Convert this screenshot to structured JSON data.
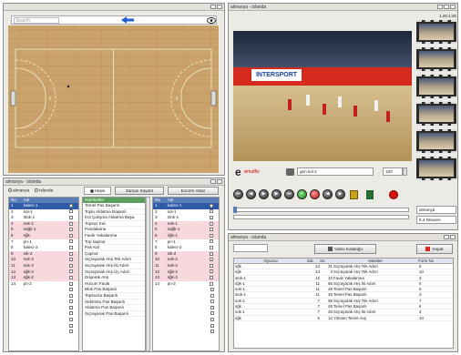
{
  "court_window": {
    "search_placeholder": "Search"
  },
  "video_window": {
    "title": "almanya - islanda"
  },
  "video": {
    "banner": "INTERSPORT",
    "brand_letter": "e",
    "brand_name": "vimaffix",
    "camera": "gen kol 2",
    "zoom": "100"
  },
  "filmstrip": {
    "timecode": "1:25:1:25"
  },
  "side_panel": {
    "team_select": "almanya",
    "size_select": "6.4 Nüvuen"
  },
  "roster_window": {
    "title": "almanya - islanda",
    "radio_team1": "almanya",
    "radio_team2": "islanda",
    "radio_hepsi": "Hepsi",
    "btn_zaman": "Zaman Kaydet",
    "btn_excel": "Excel'e Aktar",
    "left_table": {
      "headers": [
        "No",
        "Adı",
        ""
      ],
      "rows": [
        {
          "no": "1",
          "name": "kaleci-1"
        },
        {
          "no": "2",
          "name": "sol-1"
        },
        {
          "no": "3",
          "name": "stok-1"
        },
        {
          "no": "4",
          "name": "sok-1"
        },
        {
          "no": "5",
          "name": "sağk-1"
        },
        {
          "no": "6",
          "name": "sğk"
        },
        {
          "no": "7",
          "name": "pn-1"
        },
        {
          "no": "8",
          "name": "kaleci-2"
        },
        {
          "no": "9",
          "name": "sik-2"
        },
        {
          "no": "10",
          "name": "sok-2"
        },
        {
          "no": "11",
          "name": "sok-2"
        },
        {
          "no": "12",
          "name": "sğk-2"
        },
        {
          "no": "13",
          "name": "sğk-2"
        },
        {
          "no": "14",
          "name": "pn-2"
        }
      ]
    },
    "actions_header": "Hareketler",
    "actions": [
      "Temel Pas Başarılı",
      "Toplu Aldatma Başarılı",
      "Kol Çalışma Aldatma Başa",
      "Topsuz Kal",
      "Pandalama",
      "Faule Yakalanma",
      "Top kapma",
      "Pas Kal",
      "Çapraz",
      "Sıçrayarak Atış Tek Adım",
      "Sıçrayarak Atış İki Adım",
      "Sıçrayarak Atış Üç Adım",
      "Düşerek Atış",
      "Hücum Faulü",
      "Blok Pas Başarılı",
      "Topsuzsa Başarılı",
      "Sektörsu Pas Başarılı",
      "Aldatma Pas Başarılı",
      "Sıçrayarak Pas Başarılı"
    ],
    "right_table": {
      "headers": [
        "No",
        "Adı",
        ""
      ],
      "rows": [
        {
          "no": "1",
          "name": "kaleci-1"
        },
        {
          "no": "2",
          "name": "sol-1"
        },
        {
          "no": "3",
          "name": "stok-1"
        },
        {
          "no": "4",
          "name": "sok-1"
        },
        {
          "no": "5",
          "name": "sağk-1"
        },
        {
          "no": "6",
          "name": "sğk-1"
        },
        {
          "no": "7",
          "name": "pn-1"
        },
        {
          "no": "8",
          "name": "kaleci-2"
        },
        {
          "no": "9",
          "name": "sik-2"
        },
        {
          "no": "10",
          "name": "sok-2"
        },
        {
          "no": "11",
          "name": "sok-2"
        },
        {
          "no": "12",
          "name": "sğk-2"
        },
        {
          "no": "13",
          "name": "sğk-2"
        },
        {
          "no": "14",
          "name": "pn-2"
        }
      ]
    }
  },
  "events_window": {
    "title": "almanya - islanda",
    "btn_video": "Video Kataloğu",
    "btn_kapat": "Kapat",
    "headers": [
      "Oyuncu",
      "Zat.",
      "Sn.",
      "Hareket",
      "Form No"
    ],
    "rows": [
      {
        "player": "sğk",
        "z": "13",
        "s": "31",
        "action": "Sıçrayarak Atış Tek Adım",
        "form": "6"
      },
      {
        "player": "sğk",
        "z": "13",
        "s": "3",
        "action": "Sıçrayarak Atış Tek Adım",
        "form": "10"
      },
      {
        "player": "stok-1",
        "z": "12",
        "s": "10",
        "action": "Faule Yakalanma",
        "form": "3"
      },
      {
        "player": "sğk-1",
        "z": "11",
        "s": "56",
        "action": "Sıçrayarak Atış İki Adım",
        "form": "5"
      },
      {
        "player": "sok-1",
        "z": "11",
        "s": "48",
        "action": "Temel Pas Başarılı",
        "form": "5"
      },
      {
        "player": "stok-1",
        "z": "11",
        "s": "45",
        "action": "Temel Pas Başarılı",
        "form": "3"
      },
      {
        "player": "sok-1",
        "z": "7",
        "s": "56",
        "action": "Sıçrayarak Atış Tek Adım",
        "form": "7"
      },
      {
        "player": "sğk",
        "z": "7",
        "s": "48",
        "action": "Temel Pas Başarılı",
        "form": "6"
      },
      {
        "player": "sok-1",
        "z": "7",
        "s": "26",
        "action": "Sıçrayarak Atış İki Adım",
        "form": "4"
      },
      {
        "player": "sğk",
        "z": "6",
        "s": "12",
        "action": "Yüksen Temel Atış",
        "form": "10"
      }
    ]
  }
}
